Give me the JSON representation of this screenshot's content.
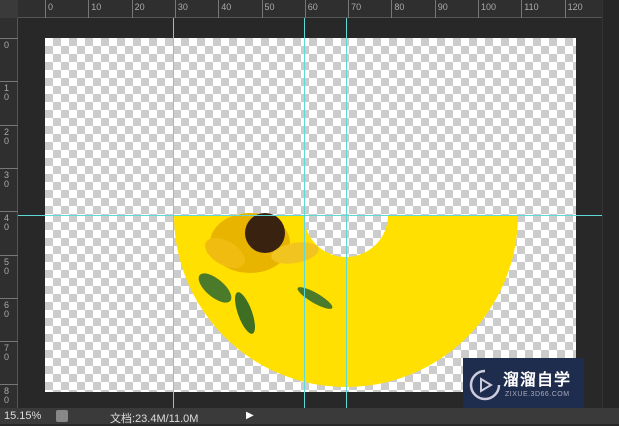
{
  "ruler": {
    "top_labels": [
      "0",
      "10",
      "20",
      "30",
      "40",
      "50",
      "60",
      "70",
      "80",
      "90",
      "100",
      "110",
      "120"
    ],
    "left_labels": [
      "0",
      "10",
      "20",
      "30",
      "40",
      "50",
      "60",
      "70",
      "80"
    ]
  },
  "status": {
    "zoom": "15.15%",
    "doc_info": "文档:23.4M/11.0M",
    "arrow": "▶"
  },
  "watermark": {
    "title": "溜溜自学",
    "subtitle": "ZIXUE.3D66.COM"
  },
  "colors": {
    "fill": "#FFE000",
    "guide": "#5fd8d8"
  }
}
